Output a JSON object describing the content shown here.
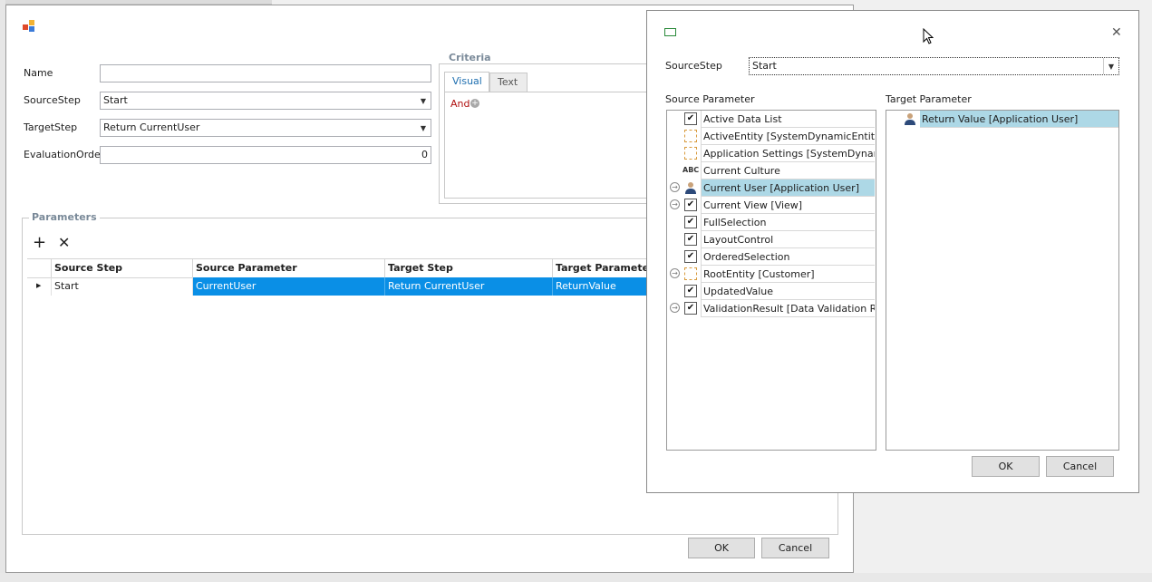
{
  "main_form": {
    "fields": {
      "name": {
        "label": "Name",
        "value": ""
      },
      "source_step": {
        "label": "SourceStep",
        "value": "Start"
      },
      "target_step": {
        "label": "TargetStep",
        "value": "Return CurrentUser"
      },
      "evaluation_order": {
        "label": "EvaluationOrder",
        "value": "0"
      }
    },
    "criteria": {
      "title": "Criteria",
      "tabs": [
        "Visual",
        "Text"
      ],
      "and_label": "And"
    },
    "parameters": {
      "title": "Parameters",
      "columns": [
        "Source Step",
        "Source Parameter",
        "Target Step",
        "Target Parameter"
      ],
      "rows": [
        {
          "source_step": "Start",
          "source_parameter": "CurrentUser",
          "target_step": "Return CurrentUser",
          "target_parameter": "ReturnValue"
        }
      ]
    },
    "buttons": {
      "ok": "OK",
      "cancel": "Cancel"
    }
  },
  "dialog": {
    "source_step_label": "SourceStep",
    "source_step_value": "Start",
    "source_parameter_label": "Source Parameter",
    "target_parameter_label": "Target Parameter",
    "source_items": [
      {
        "text": "Active Data List",
        "icon": "checkbox-icon",
        "expandable": false,
        "selected": false
      },
      {
        "text": "ActiveEntity  [SystemDynamicEntity]",
        "icon": "entity-icon",
        "expandable": false,
        "selected": false
      },
      {
        "text": "Application Settings  [SystemDynami...",
        "icon": "entity-icon",
        "expandable": false,
        "selected": false
      },
      {
        "text": "Current Culture",
        "icon": "abc-icon",
        "expandable": false,
        "selected": false
      },
      {
        "text": "Current User  [Application User]",
        "icon": "user-icon",
        "expandable": true,
        "selected": true
      },
      {
        "text": "Current View  [View]",
        "icon": "checkbox-icon",
        "expandable": true,
        "selected": false
      },
      {
        "text": "FullSelection",
        "icon": "checkbox-icon",
        "expandable": false,
        "selected": false
      },
      {
        "text": "LayoutControl",
        "icon": "checkbox-icon",
        "expandable": false,
        "selected": false
      },
      {
        "text": "OrderedSelection",
        "icon": "checkbox-icon",
        "expandable": false,
        "selected": false
      },
      {
        "text": "RootEntity  [Customer]",
        "icon": "entity-icon",
        "expandable": true,
        "selected": false
      },
      {
        "text": "UpdatedValue",
        "icon": "checkbox-icon",
        "expandable": false,
        "selected": false
      },
      {
        "text": "ValidationResult  [Data Validation Re...",
        "icon": "checkbox-icon",
        "expandable": true,
        "selected": false
      }
    ],
    "target_items": [
      {
        "text": "Return Value  [Application User]",
        "icon": "user-icon",
        "selected": true
      }
    ],
    "buttons": {
      "ok": "OK",
      "cancel": "Cancel"
    },
    "colors": {
      "selection": "#add8e6",
      "grid_selection": "#0a8fe6"
    }
  }
}
